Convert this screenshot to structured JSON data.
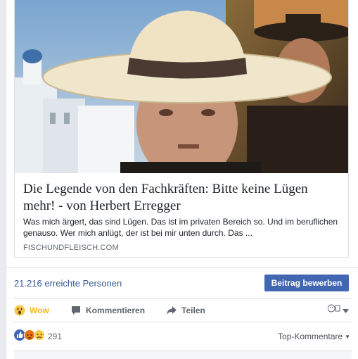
{
  "link_preview": {
    "headline": "Die Legende von den Fachkräften: Bitte keine Lügen mehr! - von Herbert Erregger",
    "description": "Was mich ärgert, das sind Lügen. Das ist im privaten Bereich so. Und im beruflichen genauso. Wer mich anlügt, der ist bei mir unten durch. Das ...",
    "domain": "FISCHUNDFLEISCH.COM"
  },
  "insights": {
    "reach_text": "21.216 erreichte Personen",
    "promote_label": "Beitrag bewerben"
  },
  "actions": {
    "wow_label": "Wow",
    "comment_label": "Kommentieren",
    "share_label": "Teilen"
  },
  "reactions": {
    "count": "291",
    "types": [
      "like-icon",
      "angry-icon",
      "sad-icon"
    ]
  },
  "comments": {
    "sort_label": "Top-Kommentare"
  },
  "colors": {
    "link": "#365899",
    "button": "#4267b2",
    "wow": "#f0ba15",
    "text": "#1d2129",
    "muted": "#606770"
  }
}
